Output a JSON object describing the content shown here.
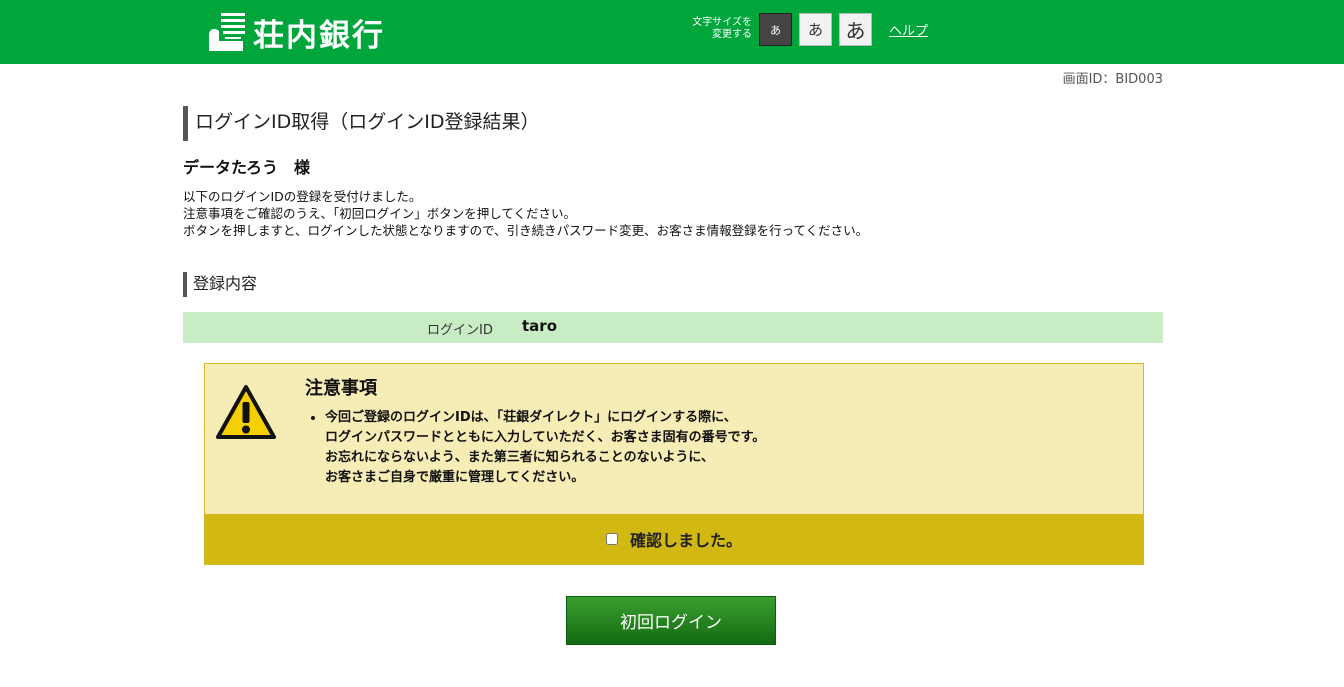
{
  "header": {
    "bank_name": "荘内銀行",
    "font_size_label_line1": "文字サイズを",
    "font_size_label_line2": "変更する",
    "font_size_buttons": [
      {
        "label": "あ",
        "selected": true
      },
      {
        "label": "あ",
        "selected": false
      },
      {
        "label": "あ",
        "selected": false
      }
    ],
    "help_label": "ヘルプ"
  },
  "screen_id": "画面ID：BID003",
  "page_title": "ログインID取得（ログインID登録結果）",
  "customer_name": "データたろう　様",
  "intro_lines": [
    "以下のログインIDの登録を受付けました。",
    "注意事項をご確認のうえ、「初回ログイン」ボタンを押してください。",
    "ボタンを押しますと、ログインした状態となりますので、引き続きパスワード変更、お客さま情報登録を行ってください。"
  ],
  "registration": {
    "section_title": "登録内容",
    "login_id_label": "ログインID",
    "login_id_value": "taro"
  },
  "notice": {
    "title": "注意事項",
    "lines": [
      "今回ご登録のログインIDは、「荘銀ダイレクト」にログインする際に、",
      "ログインパスワードとともに入力していただく、お客さま固有の番号です。",
      "お忘れにならないよう、また第三者に知られることのないように、",
      "お客さまご自身で厳重に管理してください。"
    ],
    "confirm_label": "確認しました。",
    "confirm_checked": false
  },
  "first_login_button": "初回ログイン",
  "colors": {
    "header_green": "#00a53c",
    "id_row_bg": "#c8ecc3",
    "notice_bg": "#f5ecb6",
    "confirm_bar": "#d2b812",
    "button_green": "#1d7d19"
  }
}
